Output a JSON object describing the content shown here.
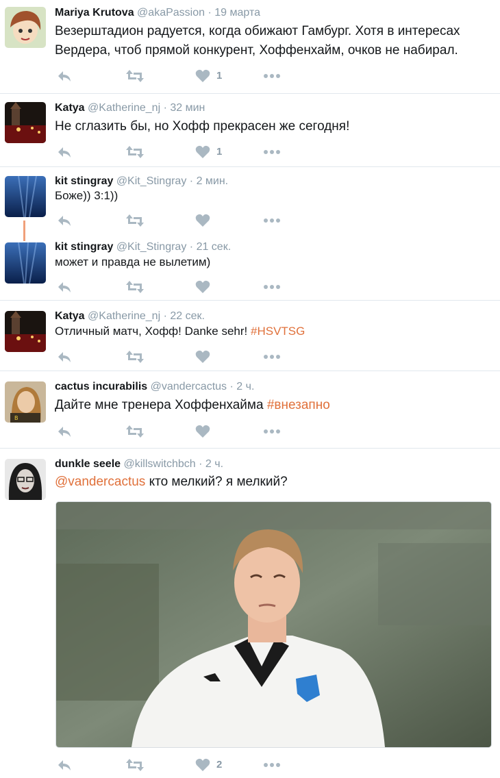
{
  "colors": {
    "link": "#e0703a",
    "muted": "#8899a6",
    "divider": "#e1e8ed"
  },
  "icons": {
    "reply": "reply-icon",
    "retweet": "retweet-icon",
    "like": "heart-icon",
    "more": "more-icon"
  },
  "tweets": [
    {
      "name": "Mariya Krutova",
      "handle": "@akaPassion",
      "sep": "·",
      "time": "19 марта",
      "text_line1": "Везерштадион радуется, когда обижают Гамбург. Хотя в интересах",
      "text_line2": "Вердера, чтоб прямой конкурент, Хоффенхайм, очков не набирал.",
      "likes": "1"
    },
    {
      "name": "Katya",
      "handle": "@Katherine_nj",
      "sep": "·",
      "time": "32 мин",
      "text": "Не сглазить бы, но Хофф прекрасен же сегодня!",
      "likes": "1"
    },
    {
      "name": "kit stingray",
      "handle": "@Kit_Stingray",
      "sep": "·",
      "time": "2 мин.",
      "text": "Боже)) 3:1))",
      "likes": ""
    },
    {
      "name": "kit stingray",
      "handle": "@Kit_Stingray",
      "sep": "·",
      "time": "21 сек.",
      "text": "может и правда не вылетим)",
      "likes": ""
    },
    {
      "name": "Katya",
      "handle": "@Katherine_nj",
      "sep": "·",
      "time": "22 сек.",
      "text": "Отличный матч, Хофф! Danke sehr! ",
      "hashtag": "#HSVTSG",
      "likes": ""
    },
    {
      "name": "cactus incurabilis",
      "handle": "@vandercactus",
      "sep": "·",
      "time": "2 ч.",
      "text": "Дайте мне тренера Хоффенхайма ",
      "hashtag": "#внезапно",
      "likes": ""
    },
    {
      "name": "dunkle seele",
      "handle": "@killswitchbch",
      "sep": "·",
      "time": "2 ч.",
      "mention": "@vandercactus",
      "text": " кто мелкий? я мелкий?",
      "likes": "2"
    }
  ]
}
